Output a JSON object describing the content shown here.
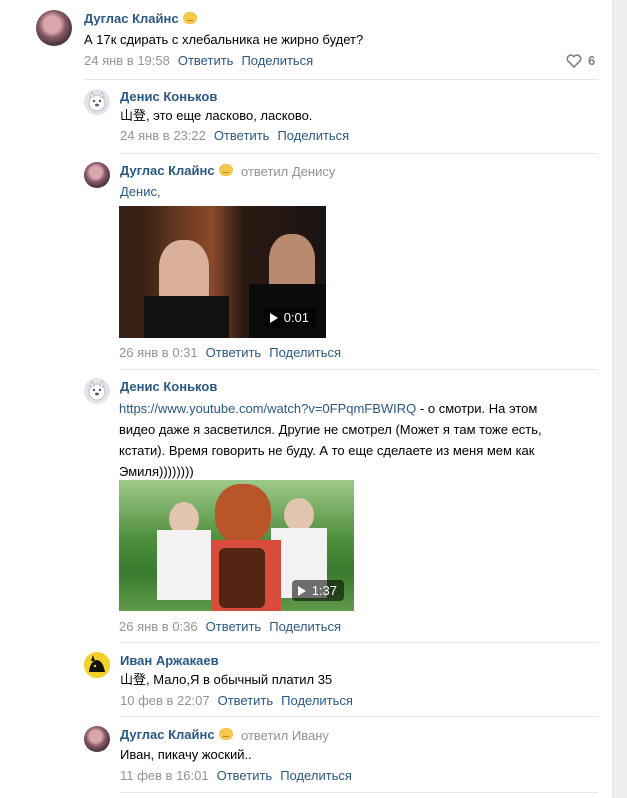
{
  "actions": {
    "reply": "Ответить",
    "share": "Поделиться"
  },
  "comments": [
    {
      "author": "Дуглас Клайнс",
      "text": "А 17к сдирать с хлебальника не жирно будет?",
      "date": "24 янв в 19:58",
      "likes": "6",
      "avatar_icon": "user-avatar"
    },
    {
      "author": "Денис Коньков",
      "text": "山登, это еще ласково, ласково.",
      "date": "24 янв в 23:22",
      "avatar_icon": "dog-avatar"
    },
    {
      "author": "Дуглас Клайнс",
      "replied_to": "ответил Денису",
      "text": "Денис,",
      "date": "26 янв в 0:31",
      "video_duration": "0:01"
    },
    {
      "author": "Денис Коньков",
      "link": "https://www.youtube.com/watch?v=0FPqmFBWIRQ",
      "text_lines": [
        " - о смотри. На этом",
        "видео даже я засветился. Другие не смотрел (Может я там тоже есть,",
        "кстати). Время говорить не буду. А то еще сделаете из меня мем как",
        "Эмиля))))))))"
      ],
      "date": "26 янв в 0:36",
      "video_duration": "1:37"
    },
    {
      "author": "Иван Аржакаев",
      "text": "山登, Мало,Я в обычный платил 35",
      "date": "10 фев в 22:07"
    },
    {
      "author": "Дуглас Клайнс",
      "replied_to": "ответил Ивану",
      "text": "Иван, пикачу жоский..",
      "date": "11 фев в 16:01"
    }
  ]
}
